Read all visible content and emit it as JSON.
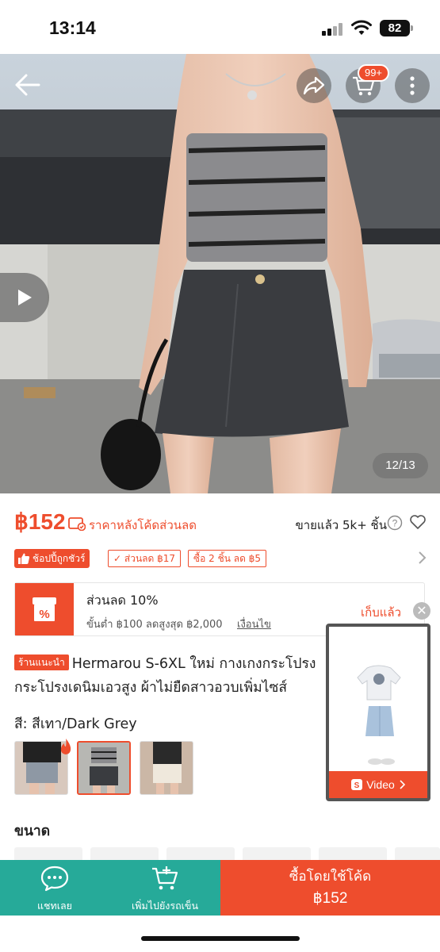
{
  "status_bar": {
    "time": "13:14",
    "battery": "82"
  },
  "gallery": {
    "cart_badge": "99+",
    "page_counter": "12/13"
  },
  "price": {
    "amount": "฿152",
    "note": "ราคาหลังโค้ดส่วนลด",
    "sold": "ขายแล้ว 5k+ ชิ้น"
  },
  "badges": {
    "mall": "ช้อปปี้ถูกชัวร์",
    "discount": "ส่วนลด ฿17",
    "bundle": "ซื้อ 2 ชิ้น ลด ฿5"
  },
  "voucher": {
    "title": "ส่วนลด 10%",
    "subtitle": "ขั้นต่ำ ฿100 ลดสูงสุด ฿2,000",
    "conditions": "เงื่อนไข",
    "collected": "เก็บแล้ว"
  },
  "product": {
    "badge": "ร้านแนะนำ",
    "title_line1": "Hermarou S-6XL ใหม่ กางเกงกระโปรง",
    "title_line2": "กระโปรงเดนิมเอวสูง ผ้าไม่ยืดสาวอวบเพิ่มไซส์",
    "color_label": "สี: สีเทา/Dark Grey",
    "size_label": "ขนาด"
  },
  "float_video": {
    "label": "Video"
  },
  "bottom_bar": {
    "chat": "แชทเลย",
    "add_to_cart": "เพิ่มไปยังรถเข็น",
    "buy_label": "ซื้อโดยใช้โค้ด",
    "buy_price": "฿152"
  },
  "colors": {
    "accent": "#ee4d2d",
    "teal": "#26aa99"
  },
  "icons": [
    "back-arrow-icon",
    "share-icon",
    "cart-icon",
    "more-icon",
    "play-icon",
    "help-icon",
    "heart-icon",
    "chevron-right-icon",
    "chat-icon",
    "add-cart-icon"
  ]
}
